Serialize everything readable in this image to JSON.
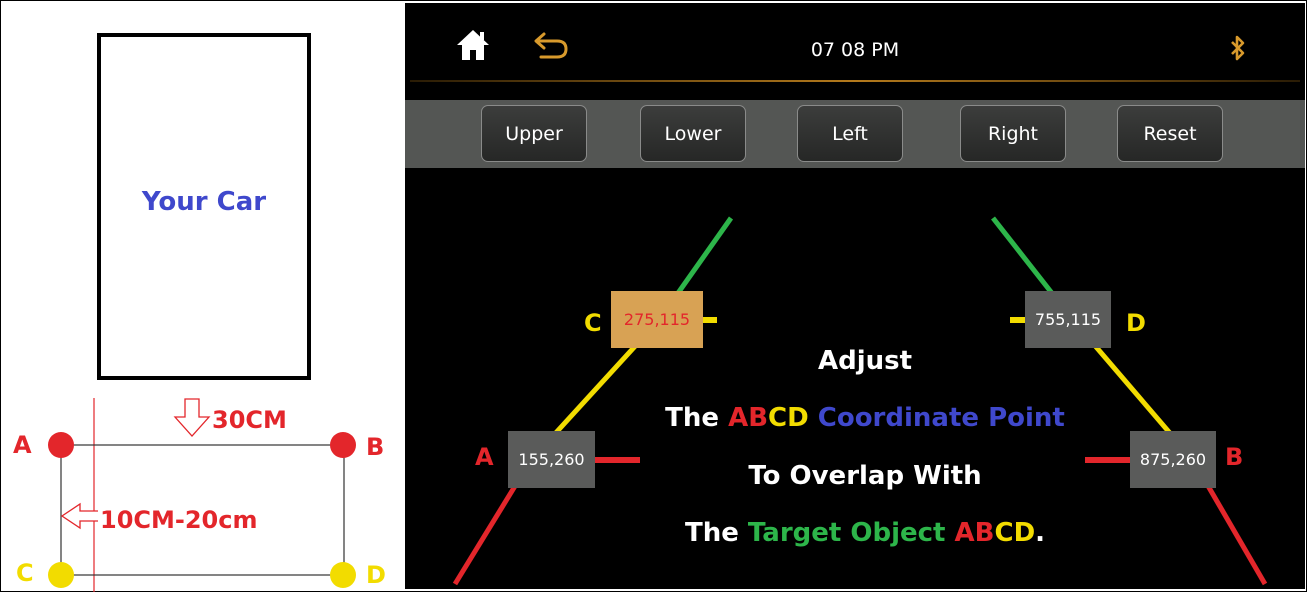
{
  "diagram": {
    "car_label": "Your Car",
    "gap_label": "30CM",
    "side_label": "10CM-20cm",
    "points": {
      "a": "A",
      "b": "B",
      "c": "C",
      "d": "D"
    },
    "colors": {
      "ab": "#e3262b",
      "cd": "#f2dc00",
      "car_text": "#3f48cc"
    }
  },
  "status_bar": {
    "time": "07 08  PM",
    "home_icon": "home-icon",
    "back_icon": "back-arrow-icon",
    "bluetooth_icon": "bluetooth-icon",
    "accent_color": "#d89a2c"
  },
  "toolbar": {
    "buttons": [
      {
        "label": "Upper"
      },
      {
        "label": "Lower"
      },
      {
        "label": "Left"
      },
      {
        "label": "Right"
      },
      {
        "label": "Reset"
      }
    ]
  },
  "guide": {
    "points": {
      "a": {
        "letter": "A",
        "coord": "155,260",
        "selected": false
      },
      "b": {
        "letter": "B",
        "coord": "875,260",
        "selected": false
      },
      "c": {
        "letter": "C",
        "coord": "275,115",
        "selected": true
      },
      "d": {
        "letter": "D",
        "coord": "755,115",
        "selected": false
      }
    },
    "line_colors": {
      "near": "#e3262b",
      "mid": "#f2dc00",
      "far": "#2db54a"
    }
  },
  "instructions": {
    "line1": "Adjust",
    "line2": {
      "w1": "The ",
      "ab": "AB",
      "cd": "CD",
      "rest": " Coordinate Point"
    },
    "line3": "To Overlap With",
    "line4": {
      "w1": "The ",
      "target": "Target Object ",
      "ab": "AB",
      "cd": "CD",
      "end": "."
    }
  }
}
